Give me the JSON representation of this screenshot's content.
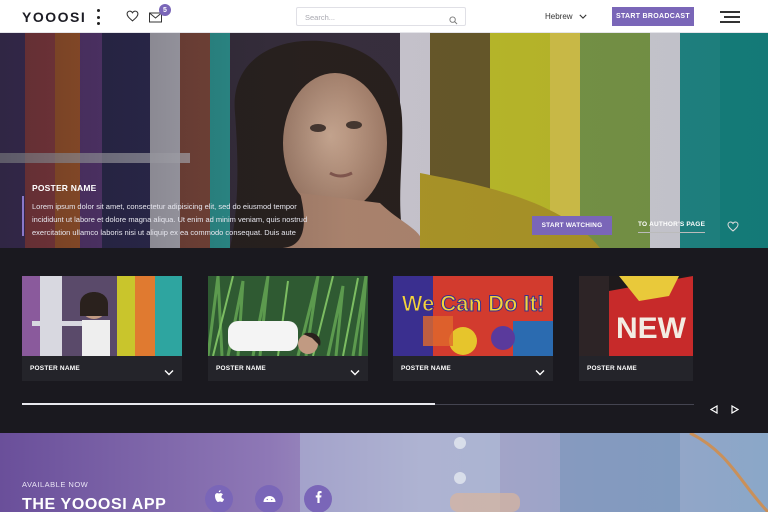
{
  "header": {
    "logo": "YOOOSI",
    "notification_count": "5",
    "search_placeholder": "Search...",
    "language": "Hebrew",
    "broadcast_label": "START BROADCAST"
  },
  "hero": {
    "poster_name": "POSTER NAME",
    "description": "Lorem ipsum dolor sit amet, consectetur adipisicing elit, sed do eiusmod tempor incididunt ut labore et dolore magna aliqua. Ut enim ad minim veniam, quis nostrud exercitation ullamco laboris nisi ut aliquip ex ea commodo consequat. Duis aute",
    "watch_label": "START WATCHING",
    "author_label": "TO AUTHOR'S PAGE",
    "thumbnails": [
      {
        "label": "POSTER NAME"
      },
      {
        "label": "POSTER NAME"
      },
      {
        "label": "POSTER NAME",
        "art_text": "We Can Do It!"
      },
      {
        "label": "POSTER NAME",
        "art_text": "NEW"
      }
    ],
    "carousel_progress": 0.615
  },
  "promo": {
    "available": "AVAILABLE NOW",
    "title": "THE YOOOSI APP"
  },
  "icons": {
    "heart": "heart-icon",
    "mail": "mail-icon",
    "search": "search-icon",
    "menu": "hamburger-menu-icon",
    "apple": "apple-icon",
    "android": "android-icon",
    "facebook": "facebook-icon"
  },
  "colors": {
    "accent": "#7a66b8",
    "dark": "#18181d",
    "card": "#24242a"
  }
}
